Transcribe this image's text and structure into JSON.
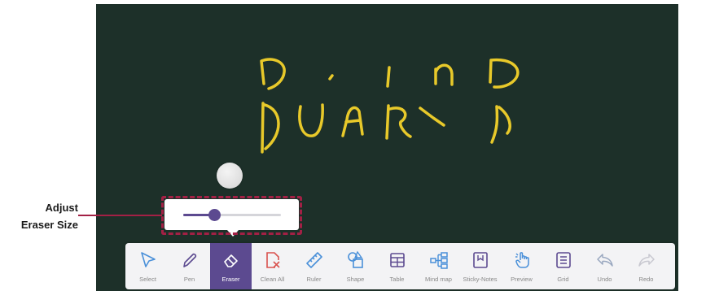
{
  "callout": {
    "line1": "Adjust",
    "line2": "Eraser Size"
  },
  "eraser_size": {
    "value": 0.32
  },
  "toolbar": {
    "tools": [
      {
        "label": "Select",
        "icon": "select-arrow-icon",
        "color": "#4a90d9"
      },
      {
        "label": "Pen",
        "icon": "pen-icon",
        "color": "#5c4a90"
      },
      {
        "label": "Eraser",
        "icon": "eraser-icon",
        "color": "#ffffff",
        "active": true
      },
      {
        "label": "Clean All",
        "icon": "clean-all-icon",
        "color": "#d9534f"
      },
      {
        "label": "Ruler",
        "icon": "ruler-icon",
        "color": "#4a90d9"
      },
      {
        "label": "Shape",
        "icon": "shape-icon",
        "color": "#4a90d9"
      },
      {
        "label": "Table",
        "icon": "table-icon",
        "color": "#5c4a90"
      },
      {
        "label": "Mind map",
        "icon": "mind-map-icon",
        "color": "#4a90d9"
      },
      {
        "label": "Sticky-Notes",
        "icon": "sticky-notes-icon",
        "color": "#5c4a90"
      },
      {
        "label": "Preview",
        "icon": "preview-hand-icon",
        "color": "#4a90d9"
      },
      {
        "label": "Grid",
        "icon": "grid-icon",
        "color": "#5c4a90"
      },
      {
        "label": "Undo",
        "icon": "undo-icon",
        "color": "#9aa8c0"
      },
      {
        "label": "Redo",
        "icon": "redo-icon",
        "color": "#c8c8d0"
      }
    ]
  },
  "colors": {
    "board": "#1d3029",
    "ink": "#e8c92a",
    "accent": "#5c4a90",
    "callout": "#a32045"
  }
}
